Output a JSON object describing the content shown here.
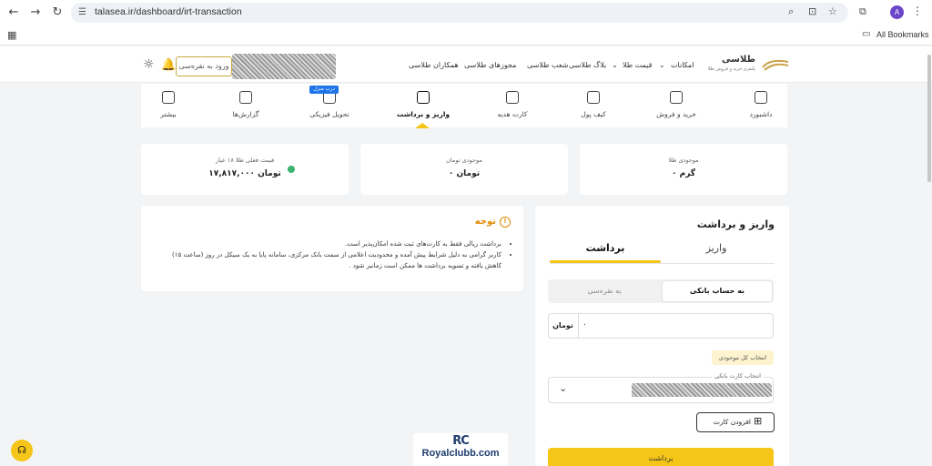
{
  "browser": {
    "url": "talasea.ir/dashboard/irt-transaction",
    "bookmarks_label": "All Bookmarks",
    "avatar_initial": "A",
    "icons": [
      "back-icon",
      "forward-icon",
      "reload-icon",
      "tune-icon",
      "zoom-icon",
      "install-icon",
      "star-icon",
      "extensions-icon",
      "menu-icon",
      "apps-icon",
      "folder-icon"
    ]
  },
  "header": {
    "logo_title": "طلاسی",
    "logo_subtitle": "پلتفرم خرید و فروش طلا",
    "nav": [
      {
        "label": "همکاران طلاسی"
      },
      {
        "label": "مجوزهای طلاسی"
      },
      {
        "label": "شعب طلاسی"
      },
      {
        "label": "بلاگ طلاسی"
      },
      {
        "label": "قیمت طلا",
        "has_dropdown": true
      },
      {
        "label": "امکانات",
        "has_dropdown": true
      }
    ],
    "login_label": "ورود به نقره‌سی"
  },
  "tabs": [
    {
      "label": "داشبورد",
      "icon": "home-icon"
    },
    {
      "label": "خرید و فروش",
      "icon": "trade-icon"
    },
    {
      "label": "کیف پول",
      "icon": "wallet-icon"
    },
    {
      "label": "کارت هدیه",
      "icon": "gift-card-icon"
    },
    {
      "label": "واریز و برداشت",
      "icon": "transfer-icon",
      "active": true
    },
    {
      "label": "تحویل فیزیکی",
      "icon": "delivery-icon",
      "badge": "درب منزل"
    },
    {
      "label": "گزارش‌ها",
      "icon": "report-icon"
    },
    {
      "label": "بیشتر",
      "icon": "more-icon"
    }
  ],
  "stats": [
    {
      "label": "موجودی طلا",
      "value": "۰ گرم"
    },
    {
      "label": "موجودی تومان",
      "value": "۰ تومان"
    },
    {
      "label": "قیمت فعلی طلا ۱۸ عیار",
      "value": "۱۷,۸۱۷,۰۰۰ تومان"
    }
  ],
  "notice": {
    "title": "توجه",
    "items": [
      "برداشت ریالی فقط به کارت‌های ثبت شده امکان‌پذیر است.",
      "کاربر گرامی به دلیل شرایط پیش آمده و محدودیت اعلامی از سمت بانک مرکزی، سامانه پایا به یک سیکل در روز (ساعت ۱۵) کاهش یافته و تسویه برداشت ها ممکن است زمانبر شود ."
    ]
  },
  "panel": {
    "title": "واریز و برداشت",
    "tabs": [
      {
        "label": "واریز"
      },
      {
        "label": "برداشت",
        "active": true
      }
    ],
    "segments": [
      {
        "label": "به حساب بانکی",
        "active": true
      },
      {
        "label": "به نقره‌سی"
      }
    ],
    "amount": {
      "unit": "تومان",
      "value": "۰"
    },
    "all_balance_label": "انتخاب کل موجودی",
    "card_select_label": "انتخاب کارت بانکی",
    "add_card_label": "افزودن کارت",
    "submit_label": "برداشت"
  },
  "watermark": {
    "mark": "RC",
    "text": "Royalclubb.com"
  },
  "colors": {
    "accent": "#f5c518",
    "link": "#1d73e8",
    "warning": "#e08a00",
    "live": "#3cb371"
  }
}
